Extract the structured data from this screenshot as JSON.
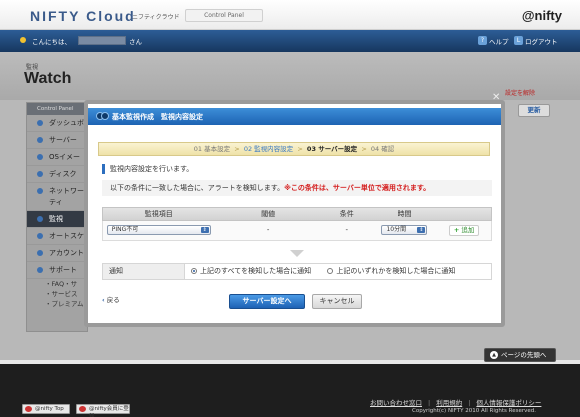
{
  "header": {
    "brand": "NIFTY Cloud",
    "brand_sub": "ニフティクラウド",
    "control_panel": "Control Panel",
    "logo": "@nifty"
  },
  "topbar": {
    "greeting": "こんにちは、",
    "suffix": "さん",
    "help": "ヘルプ",
    "logout": "ログアウト"
  },
  "page": {
    "section_small": "監視",
    "title": "Watch",
    "right_red": "設定を解除",
    "update_button": "更新"
  },
  "sidebar": {
    "head": "Control Panel",
    "items": [
      {
        "label": "ダッシュボ"
      },
      {
        "label": "サーバー"
      },
      {
        "label": "OSイメー"
      },
      {
        "label": "ディスク"
      },
      {
        "label": "ネットワー",
        "label2": "ティ"
      },
      {
        "label": "監視"
      },
      {
        "label": "オートスケ"
      },
      {
        "label": "アカウント"
      },
      {
        "label": "サポート"
      }
    ],
    "sub": [
      "FAQ・サ",
      "サービス",
      "プレミアム"
    ]
  },
  "modal": {
    "title": "基本監視作成　監視内容設定",
    "steps": [
      "01 基本設定",
      "02 監視内容設定",
      "03 サーバー設定",
      "04 確認"
    ],
    "section_label": "監視内容設定を行います。",
    "condition_text": "以下の条件に一致した場合に、アラートを検知します。",
    "condition_warning": "※この条件は、サーバー単位で適用されます。",
    "grid_headers": [
      "監視項目",
      "閾値",
      "条件",
      "時間",
      ""
    ],
    "row": {
      "item": "PING不可",
      "threshold": "-",
      "condition": "-",
      "time": "10分間",
      "add": "追加"
    },
    "notify_label": "通知",
    "notify_option1": "上記のすべてを検知した場合に通知",
    "notify_option2": "上記のいずれかを検知した場合に通知",
    "back": "戻る",
    "next_button": "サーバー設定へ",
    "cancel_button": "キャンセル"
  },
  "page_top": "ページの先頭へ",
  "footer": {
    "nifty_top": "@nifty Top",
    "member": "@nifty会員に登録",
    "links": [
      "お問い合わせ窓口",
      "利用規約",
      "個人情報保護ポリシー"
    ],
    "copyright": "Copyright(c) NIFTY 2010 All Rights Reserved."
  }
}
